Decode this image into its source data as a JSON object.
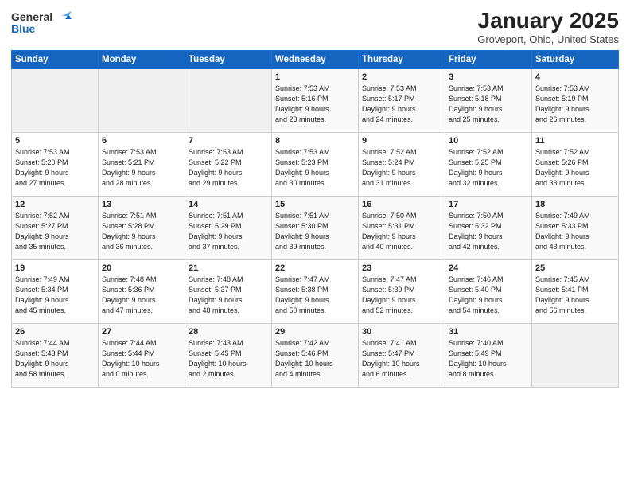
{
  "header": {
    "logo_general": "General",
    "logo_blue": "Blue",
    "month_year": "January 2025",
    "location": "Groveport, Ohio, United States"
  },
  "weekdays": [
    "Sunday",
    "Monday",
    "Tuesday",
    "Wednesday",
    "Thursday",
    "Friday",
    "Saturday"
  ],
  "weeks": [
    [
      {
        "day": "",
        "info": ""
      },
      {
        "day": "",
        "info": ""
      },
      {
        "day": "",
        "info": ""
      },
      {
        "day": "1",
        "info": "Sunrise: 7:53 AM\nSunset: 5:16 PM\nDaylight: 9 hours\nand 23 minutes."
      },
      {
        "day": "2",
        "info": "Sunrise: 7:53 AM\nSunset: 5:17 PM\nDaylight: 9 hours\nand 24 minutes."
      },
      {
        "day": "3",
        "info": "Sunrise: 7:53 AM\nSunset: 5:18 PM\nDaylight: 9 hours\nand 25 minutes."
      },
      {
        "day": "4",
        "info": "Sunrise: 7:53 AM\nSunset: 5:19 PM\nDaylight: 9 hours\nand 26 minutes."
      }
    ],
    [
      {
        "day": "5",
        "info": "Sunrise: 7:53 AM\nSunset: 5:20 PM\nDaylight: 9 hours\nand 27 minutes."
      },
      {
        "day": "6",
        "info": "Sunrise: 7:53 AM\nSunset: 5:21 PM\nDaylight: 9 hours\nand 28 minutes."
      },
      {
        "day": "7",
        "info": "Sunrise: 7:53 AM\nSunset: 5:22 PM\nDaylight: 9 hours\nand 29 minutes."
      },
      {
        "day": "8",
        "info": "Sunrise: 7:53 AM\nSunset: 5:23 PM\nDaylight: 9 hours\nand 30 minutes."
      },
      {
        "day": "9",
        "info": "Sunrise: 7:52 AM\nSunset: 5:24 PM\nDaylight: 9 hours\nand 31 minutes."
      },
      {
        "day": "10",
        "info": "Sunrise: 7:52 AM\nSunset: 5:25 PM\nDaylight: 9 hours\nand 32 minutes."
      },
      {
        "day": "11",
        "info": "Sunrise: 7:52 AM\nSunset: 5:26 PM\nDaylight: 9 hours\nand 33 minutes."
      }
    ],
    [
      {
        "day": "12",
        "info": "Sunrise: 7:52 AM\nSunset: 5:27 PM\nDaylight: 9 hours\nand 35 minutes."
      },
      {
        "day": "13",
        "info": "Sunrise: 7:51 AM\nSunset: 5:28 PM\nDaylight: 9 hours\nand 36 minutes."
      },
      {
        "day": "14",
        "info": "Sunrise: 7:51 AM\nSunset: 5:29 PM\nDaylight: 9 hours\nand 37 minutes."
      },
      {
        "day": "15",
        "info": "Sunrise: 7:51 AM\nSunset: 5:30 PM\nDaylight: 9 hours\nand 39 minutes."
      },
      {
        "day": "16",
        "info": "Sunrise: 7:50 AM\nSunset: 5:31 PM\nDaylight: 9 hours\nand 40 minutes."
      },
      {
        "day": "17",
        "info": "Sunrise: 7:50 AM\nSunset: 5:32 PM\nDaylight: 9 hours\nand 42 minutes."
      },
      {
        "day": "18",
        "info": "Sunrise: 7:49 AM\nSunset: 5:33 PM\nDaylight: 9 hours\nand 43 minutes."
      }
    ],
    [
      {
        "day": "19",
        "info": "Sunrise: 7:49 AM\nSunset: 5:34 PM\nDaylight: 9 hours\nand 45 minutes."
      },
      {
        "day": "20",
        "info": "Sunrise: 7:48 AM\nSunset: 5:36 PM\nDaylight: 9 hours\nand 47 minutes."
      },
      {
        "day": "21",
        "info": "Sunrise: 7:48 AM\nSunset: 5:37 PM\nDaylight: 9 hours\nand 48 minutes."
      },
      {
        "day": "22",
        "info": "Sunrise: 7:47 AM\nSunset: 5:38 PM\nDaylight: 9 hours\nand 50 minutes."
      },
      {
        "day": "23",
        "info": "Sunrise: 7:47 AM\nSunset: 5:39 PM\nDaylight: 9 hours\nand 52 minutes."
      },
      {
        "day": "24",
        "info": "Sunrise: 7:46 AM\nSunset: 5:40 PM\nDaylight: 9 hours\nand 54 minutes."
      },
      {
        "day": "25",
        "info": "Sunrise: 7:45 AM\nSunset: 5:41 PM\nDaylight: 9 hours\nand 56 minutes."
      }
    ],
    [
      {
        "day": "26",
        "info": "Sunrise: 7:44 AM\nSunset: 5:43 PM\nDaylight: 9 hours\nand 58 minutes."
      },
      {
        "day": "27",
        "info": "Sunrise: 7:44 AM\nSunset: 5:44 PM\nDaylight: 10 hours\nand 0 minutes."
      },
      {
        "day": "28",
        "info": "Sunrise: 7:43 AM\nSunset: 5:45 PM\nDaylight: 10 hours\nand 2 minutes."
      },
      {
        "day": "29",
        "info": "Sunrise: 7:42 AM\nSunset: 5:46 PM\nDaylight: 10 hours\nand 4 minutes."
      },
      {
        "day": "30",
        "info": "Sunrise: 7:41 AM\nSunset: 5:47 PM\nDaylight: 10 hours\nand 6 minutes."
      },
      {
        "day": "31",
        "info": "Sunrise: 7:40 AM\nSunset: 5:49 PM\nDaylight: 10 hours\nand 8 minutes."
      },
      {
        "day": "",
        "info": ""
      }
    ]
  ]
}
